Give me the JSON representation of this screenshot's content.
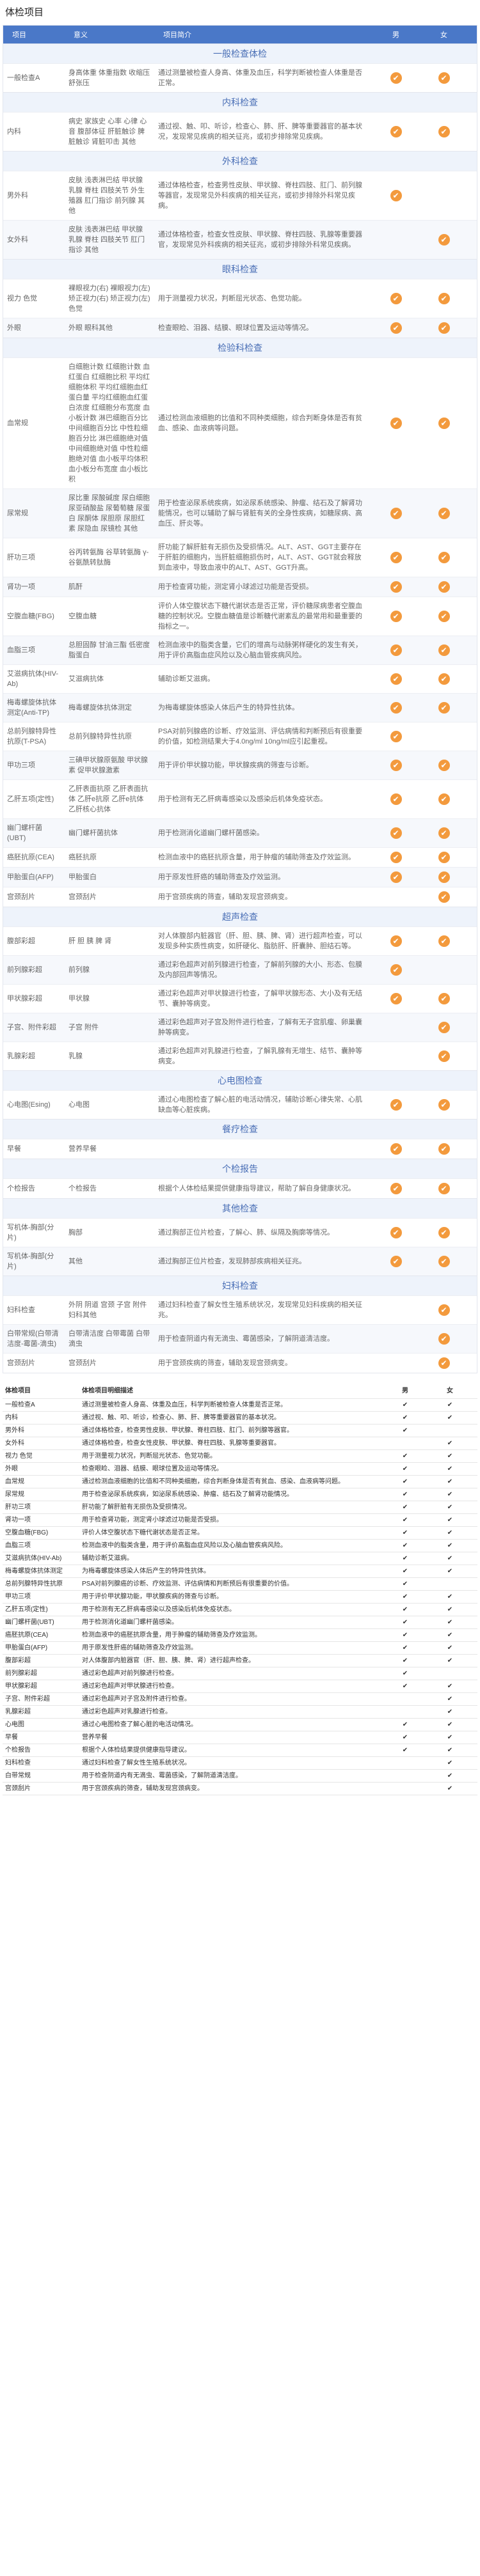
{
  "page": {
    "title": "体检项目"
  },
  "header": {
    "col_name": "项目",
    "col_significance": "意义",
    "col_desc": "项目简介",
    "col_male": "男",
    "col_female": "女"
  },
  "sections": [
    {
      "title": "一般检查体检",
      "rows": [
        {
          "name": "一般检查A",
          "significance": "身高体重 体重指数 收缩压 舒张压",
          "desc": "通过测量被检查人身高、体重及血压，科学判断被检查人体重是否正常。",
          "male": "✔",
          "female": "✔",
          "h": 44
        }
      ]
    },
    {
      "title": "内科检查",
      "rows": [
        {
          "name": "内科",
          "significance": "病史 家族史 心率 心律 心音 腹部体征 肝脏触诊 脾脏触诊 肾脏叩击 其他",
          "desc": "通过视、触、叩、听诊，检查心、肺、肝、脾等重要器官的基本状况，发现常见疾病的相关征兆，或初步排除常见疾病。",
          "male": "✔",
          "female": "✔",
          "h": 60
        }
      ]
    },
    {
      "title": "外科检查",
      "rows": [
        {
          "name": "男外科",
          "significance": "皮肤 浅表淋巴结 甲状腺 乳腺 脊柱 四肢关节 外生殖器 肛门指诊 前列腺 其他",
          "desc": "通过体格检查，检查男性皮肤、甲状腺、脊柱四肢、肛门、前列腺等器官，发现常见外科疾病的相关征兆，或初步排除外科常见疾病。",
          "male": "✔",
          "female": "",
          "h": 62
        },
        {
          "name": "女外科",
          "significance": "皮肤 浅表淋巴结 甲状腺 乳腺 脊柱 四肢关节 肛门指诊 其他",
          "desc": "通过体格检查，检查女性皮肤、甲状腺、脊柱四肢、乳腺等重要器官，发现常见外科疾病的相关征兆，或初步排除外科常见疾病。",
          "male": "",
          "female": "✔",
          "h": 62
        }
      ]
    },
    {
      "title": "眼科检查",
      "rows": [
        {
          "name": "视力 色觉",
          "significance": "裸眼视力(右) 裸眼视力(左) 矫正视力(右) 矫正视力(左) 色觉",
          "desc": "用于测量视力状况，判断屈光状态、色觉功能。",
          "male": "✔",
          "female": "✔",
          "h": 44
        },
        {
          "name": "外眼",
          "significance": "外眼 眼科其他",
          "desc": "检查眼睑、泪器、结膜、眼球位置及运动等情况。",
          "male": "✔",
          "female": "✔",
          "h": 40
        }
      ]
    },
    {
      "title": "检验科检查",
      "rows": [
        {
          "name": "血常规",
          "significance": "白细胞计数 红细胞计数 血红蛋白 红细胞比积 平均红细胞体积 平均红细胞血红蛋白量 平均红细胞血红蛋白浓度 红细胞分布宽度 血小板计数 淋巴细胞百分比 中间细胞百分比 中性粒细胞百分比 淋巴细胞绝对值 中间细胞绝对值 中性粒细胞绝对值 血小板平均体积 血小板分布宽度 血小板比积",
          "desc": "通过检测血液细胞的比值和不同种类细胞，综合判断身体是否有贫血、感染、血液病等问题。",
          "male": "✔",
          "female": "✔",
          "h": 148
        },
        {
          "name": "尿常规",
          "significance": "尿比重 尿酸碱度 尿白细胞 尿亚硝酸盐 尿葡萄糖 尿蛋白 尿酮体 尿胆原 尿胆红素 尿隐血 尿镜检 其他",
          "desc": "用于检查泌尿系统疾病，如泌尿系统感染、肿瘤、结石及了解肾功能情况，也可以辅助了解与肾脏有关的全身性疾病，如糖尿病、高血压、肝炎等。",
          "male": "✔",
          "female": "✔",
          "h": 78
        },
        {
          "name": "肝功三项",
          "significance": "谷丙转氨酶 谷草转氨酶 γ-谷氨酰转肽酶",
          "desc": "肝功能了解肝脏有无损伤及受损情况。ALT、AST、GGT主要存在于肝脏的细胞内，当肝脏细胞损伤时，ALT、AST、GGT就会释放到血液中，导致血液中的ALT、AST、GGT升高。",
          "male": "✔",
          "female": "✔",
          "h": 78
        },
        {
          "name": "肾功一项",
          "significance": "肌酐",
          "desc": "用于检查肾功能，测定肾小球滤过功能是否受损。",
          "male": "✔",
          "female": "✔",
          "h": 40
        },
        {
          "name": "空腹血糖(FBG)",
          "significance": "空腹血糖",
          "desc": "评价人体空腹状态下糖代谢状态是否正常，评价糖尿病患者空腹血糖的控制状况。空腹血糖值是诊断糖代谢紊乱的最常用和最重要的指标之一。",
          "male": "✔",
          "female": "✔",
          "h": 58
        },
        {
          "name": "血脂三项",
          "significance": "总胆固醇 甘油三酯 低密度脂蛋白",
          "desc": "检测血液中的脂类含量，它们的增高与动脉粥样硬化的发生有关，用于评价高脂血症风险以及心脑血管疾病风险。",
          "male": "✔",
          "female": "✔",
          "h": 50
        },
        {
          "name": "艾滋病抗体(HIV-Ab)",
          "significance": "艾滋病抗体",
          "desc": "辅助诊断艾滋病。",
          "male": "✔",
          "female": "✔",
          "h": 40
        },
        {
          "name": "梅毒螺旋体抗体测定(Anti-TP)",
          "significance": "梅毒螺旋体抗体测定",
          "desc": "为梅毒螺旋体感染人体后产生的特异性抗体。",
          "male": "✔",
          "female": "✔",
          "h": 44
        },
        {
          "name": "总前列腺特异性抗原(T-PSA)",
          "significance": "总前列腺特异性抗原",
          "desc": "PSA对前列腺癌的诊断、疗效监测、评估病情和判断预后有很重要的价值，如检测结果大于4.0ng/ml 10ng/ml应引起重视。",
          "male": "✔",
          "female": "",
          "h": 56
        },
        {
          "name": "甲功三项",
          "significance": "三碘甲状腺原氨酸 甲状腺素 促甲状腺激素",
          "desc": "用于评价甲状腺功能，甲状腺疾病的筛查与诊断。",
          "male": "✔",
          "female": "✔",
          "h": 46
        },
        {
          "name": "乙肝五项(定性)",
          "significance": "乙肝表面抗原 乙肝表面抗体 乙肝e抗原 乙肝e抗体 乙肝核心抗体",
          "desc": "用于检测有无乙肝病毒感染以及感染后机体免疫状态。",
          "male": "✔",
          "female": "✔",
          "h": 64
        },
        {
          "name": "幽门螺杆菌(UBT)",
          "significance": "幽门螺杆菌抗体",
          "desc": "用于检测消化道幽门螺杆菌感染。",
          "male": "✔",
          "female": "✔",
          "h": 40
        },
        {
          "name": "癌胚抗原(CEA)",
          "significance": "癌胚抗原",
          "desc": "检测血液中的癌胚抗原含量，用于肿瘤的辅助筛查及疗效监测。",
          "male": "✔",
          "female": "✔",
          "h": 44
        },
        {
          "name": "甲胎蛋白(AFP)",
          "significance": "甲胎蛋白",
          "desc": "用于原发性肝癌的辅助筛查及疗效监测。",
          "male": "✔",
          "female": "✔",
          "h": 44
        },
        {
          "name": "宫颈刮片",
          "significance": "宫颈刮片",
          "desc": "用于宫颈疾病的筛查，辅助发现宫颈病变。",
          "male": "",
          "female": "✔",
          "h": 40
        }
      ]
    },
    {
      "title": "超声检查",
      "rows": [
        {
          "name": "腹部彩超",
          "significance": "肝 胆 胰 脾 肾",
          "desc": "对人体腹部内脏器官（肝、胆、胰、脾、肾）进行超声检查，可以发现多种实质性病变，如肝硬化、脂肪肝、肝囊肿、胆结石等。",
          "male": "✔",
          "female": "✔",
          "h": 62
        },
        {
          "name": "前列腺彩超",
          "significance": "前列腺",
          "desc": "通过彩色超声对前列腺进行检查，了解前列腺的大小、形态、包膜及内部回声等情况。",
          "male": "✔",
          "female": "",
          "h": 44
        },
        {
          "name": "甲状腺彩超",
          "significance": "甲状腺",
          "desc": "通过彩色超声对甲状腺进行检查，了解甲状腺形态、大小及有无结节、囊肿等病变。",
          "male": "✔",
          "female": "✔",
          "h": 62
        },
        {
          "name": "子宫、附件彩超",
          "significance": "子宫 附件",
          "desc": "通过彩色超声对子宫及附件进行检查，了解有无子宫肌瘤、卵巢囊肿等病变。",
          "male": "",
          "female": "✔",
          "h": 44
        },
        {
          "name": "乳腺彩超",
          "significance": "乳腺",
          "desc": "通过彩色超声对乳腺进行检查，了解乳腺有无增生、结节、囊肿等病变。",
          "male": "",
          "female": "✔",
          "h": 44
        }
      ]
    },
    {
      "title": "心电图检查",
      "rows": [
        {
          "name": "心电图(Esing)",
          "significance": "心电图",
          "desc": "通过心电图检查了解心脏的电活动情况，辅助诊断心律失常、心肌缺血等心脏疾病。",
          "male": "✔",
          "female": "✔",
          "h": 64
        }
      ]
    },
    {
      "title": "餐疗检查",
      "rows": [
        {
          "name": "早餐",
          "significance": "营养早餐",
          "desc": "",
          "male": "✔",
          "female": "✔",
          "h": 40
        }
      ]
    },
    {
      "title": "个检报告",
      "rows": [
        {
          "name": "个检报告",
          "significance": "个检报告",
          "desc": "根据个人体检结果提供健康指导建议，帮助了解自身健康状况。",
          "male": "✔",
          "female": "✔",
          "h": 62
        }
      ]
    },
    {
      "title": "其他检查",
      "rows": [
        {
          "name": "写机体-胸部(分片)",
          "significance": "胸部",
          "desc": "通过胸部正位片检查，了解心、肺、纵隔及胸廓等情况。",
          "male": "✔",
          "female": "✔",
          "h": 48
        },
        {
          "name": "写机体-胸部(分片)",
          "significance": "其他",
          "desc": "通过胸部正位片检查，发现肺部疾病相关征兆。",
          "male": "✔",
          "female": "✔",
          "h": 48
        }
      ]
    },
    {
      "title": "妇科检查",
      "rows": [
        {
          "name": "妇科检查",
          "significance": "外阴 阴道 宫颈 子宫 附件 妇科其他",
          "desc": "通过妇科检查了解女性生殖系统状况，发现常见妇科疾病的相关征兆。",
          "male": "",
          "female": "✔",
          "h": 48
        },
        {
          "name": "白带常规(白带清洁度-霉菌-滴虫)",
          "significance": "白带清洁度 白带霉菌 白带滴虫",
          "desc": "用于检查阴道内有无滴虫、霉菌感染，了解阴道清洁度。",
          "male": "",
          "female": "✔",
          "h": 48
        },
        {
          "name": "宫颈刮片",
          "significance": "宫颈刮片",
          "desc": "用于宫颈疾病的筛查，辅助发现宫颈病变。",
          "male": "",
          "female": "✔",
          "h": 48
        }
      ]
    }
  ],
  "plain_list": {
    "header": {
      "name": "体检项目",
      "desc": "体检项目明细描述",
      "male": "男",
      "female": "女"
    },
    "rows": [
      {
        "name": "一般检查A",
        "desc": "通过测量被检查人身高、体重及血压，科学判断被检查人体重是否正常。",
        "male": "✔",
        "female": "✔"
      },
      {
        "name": "内科",
        "desc": "通过视、触、叩、听诊，检查心、肺、肝、脾等重要器官的基本状况。",
        "male": "✔",
        "female": "✔"
      },
      {
        "name": "男外科",
        "desc": "通过体格检查，检查男性皮肤、甲状腺、脊柱四肢、肛门、前列腺等器官。",
        "male": "✔",
        "female": ""
      },
      {
        "name": "女外科",
        "desc": "通过体格检查，检查女性皮肤、甲状腺、脊柱四肢、乳腺等重要器官。",
        "male": "",
        "female": "✔"
      },
      {
        "name": "视力 色觉",
        "desc": "用于测量视力状况，判断屈光状态、色觉功能。",
        "male": "✔",
        "female": "✔"
      },
      {
        "name": "外眼",
        "desc": "检查眼睑、泪器、结膜、眼球位置及运动等情况。",
        "male": "✔",
        "female": "✔"
      },
      {
        "name": "血常规",
        "desc": "通过检测血液细胞的比值和不同种类细胞，综合判断身体是否有贫血、感染、血液病等问题。",
        "male": "✔",
        "female": "✔"
      },
      {
        "name": "尿常规",
        "desc": "用于检查泌尿系统疾病，如泌尿系统感染、肿瘤、结石及了解肾功能情况。",
        "male": "✔",
        "female": "✔"
      },
      {
        "name": "肝功三项",
        "desc": "肝功能了解肝脏有无损伤及受损情况。",
        "male": "✔",
        "female": "✔"
      },
      {
        "name": "肾功一项",
        "desc": "用于检查肾功能，测定肾小球滤过功能是否受损。",
        "male": "✔",
        "female": "✔"
      },
      {
        "name": "空腹血糖(FBG)",
        "desc": "评价人体空腹状态下糖代谢状态是否正常。",
        "male": "✔",
        "female": "✔"
      },
      {
        "name": "血脂三项",
        "desc": "检测血液中的脂类含量，用于评价高脂血症风险以及心脑血管疾病风险。",
        "male": "✔",
        "female": "✔"
      },
      {
        "name": "艾滋病抗体(HIV-Ab)",
        "desc": "辅助诊断艾滋病。",
        "male": "✔",
        "female": "✔"
      },
      {
        "name": "梅毒螺旋体抗体测定",
        "desc": "为梅毒螺旋体感染人体后产生的特异性抗体。",
        "male": "✔",
        "female": "✔"
      },
      {
        "name": "总前列腺特异性抗原",
        "desc": "PSA对前列腺癌的诊断、疗效监测、评估病情和判断预后有很重要的价值。",
        "male": "✔",
        "female": ""
      },
      {
        "name": "甲功三项",
        "desc": "用于评价甲状腺功能，甲状腺疾病的筛查与诊断。",
        "male": "✔",
        "female": "✔"
      },
      {
        "name": "乙肝五项(定性)",
        "desc": "用于检测有无乙肝病毒感染以及感染后机体免疫状态。",
        "male": "✔",
        "female": "✔"
      },
      {
        "name": "幽门螺杆菌(UBT)",
        "desc": "用于检测消化道幽门螺杆菌感染。",
        "male": "✔",
        "female": "✔"
      },
      {
        "name": "癌胚抗原(CEA)",
        "desc": "检测血液中的癌胚抗原含量，用于肿瘤的辅助筛查及疗效监测。",
        "male": "✔",
        "female": "✔"
      },
      {
        "name": "甲胎蛋白(AFP)",
        "desc": "用于原发性肝癌的辅助筛查及疗效监测。",
        "male": "✔",
        "female": "✔"
      },
      {
        "name": "腹部彩超",
        "desc": "对人体腹部内脏器官（肝、胆、胰、脾、肾）进行超声检查。",
        "male": "✔",
        "female": "✔"
      },
      {
        "name": "前列腺彩超",
        "desc": "通过彩色超声对前列腺进行检查。",
        "male": "✔",
        "female": ""
      },
      {
        "name": "甲状腺彩超",
        "desc": "通过彩色超声对甲状腺进行检查。",
        "male": "✔",
        "female": "✔"
      },
      {
        "name": "子宫、附件彩超",
        "desc": "通过彩色超声对子宫及附件进行检查。",
        "male": "",
        "female": "✔"
      },
      {
        "name": "乳腺彩超",
        "desc": "通过彩色超声对乳腺进行检查。",
        "male": "",
        "female": "✔"
      },
      {
        "name": "心电图",
        "desc": "通过心电图检查了解心脏的电活动情况。",
        "male": "✔",
        "female": "✔"
      },
      {
        "name": "早餐",
        "desc": "营养早餐",
        "male": "✔",
        "female": "✔"
      },
      {
        "name": "个检报告",
        "desc": "根据个人体检结果提供健康指导建议。",
        "male": "✔",
        "female": "✔"
      },
      {
        "name": "妇科检查",
        "desc": "通过妇科检查了解女性生殖系统状况。",
        "male": "",
        "female": "✔"
      },
      {
        "name": "白带常规",
        "desc": "用于检查阴道内有无滴虫、霉菌感染，了解阴道清洁度。",
        "male": "",
        "female": "✔"
      },
      {
        "name": "宫颈刮片",
        "desc": "用于宫颈疾病的筛查，辅助发现宫颈病变。",
        "male": "",
        "female": "✔"
      }
    ]
  },
  "colors": {
    "header_bg": "#4a78c8",
    "section_text": "#4a6fb6",
    "check": "#f39a3d"
  }
}
